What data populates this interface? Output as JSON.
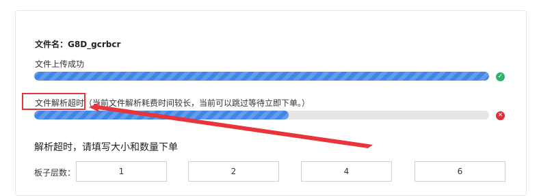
{
  "file": {
    "name_label": "文件名：G8D_gcrbcr"
  },
  "upload": {
    "status": "文件上传成功",
    "progress": 1.0,
    "icon": "check-circle-icon"
  },
  "parse": {
    "status": "文件解析超时",
    "note": "（当前文件解析耗费时间较长，当前可以跳过等待立即下单。）",
    "progress": 0.56,
    "icon": "error-circle-icon"
  },
  "manual": {
    "title": "解析超时，请填写大小和数量下单",
    "layers_label": "板子层数：",
    "layer_options": [
      "1",
      "2",
      "4",
      "6"
    ]
  },
  "colors": {
    "accent": "#3f86e5",
    "success": "#2db36a",
    "error": "#e6293b",
    "annotation": "#e8343a"
  }
}
